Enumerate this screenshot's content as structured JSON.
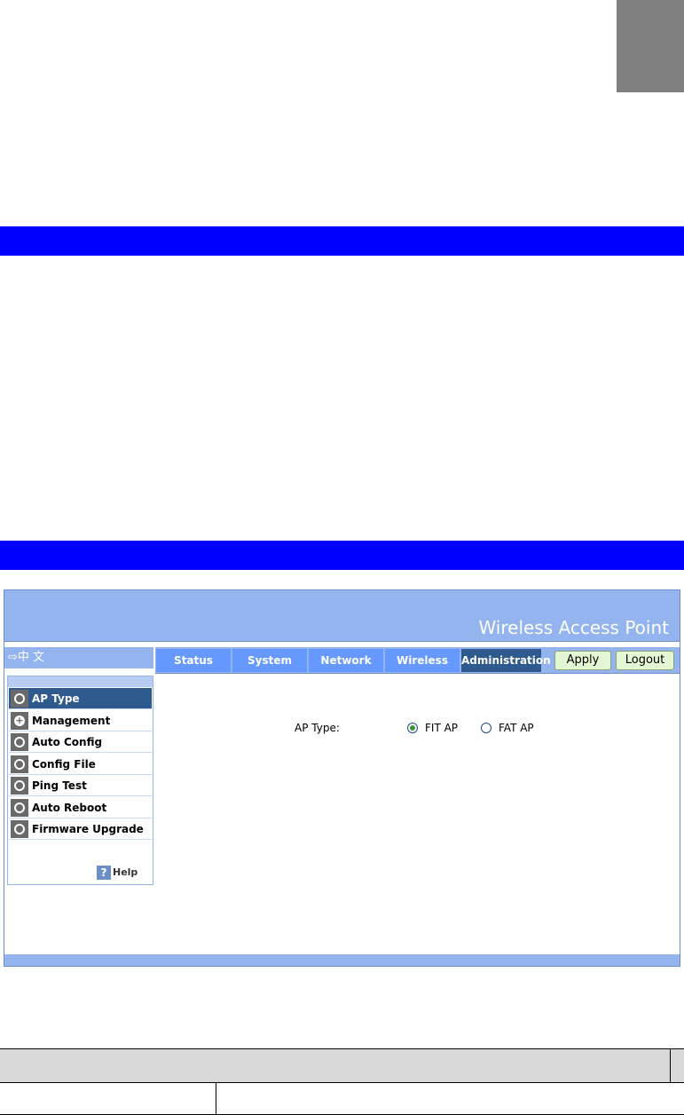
{
  "header": {
    "title": "Wireless Access Point"
  },
  "language_link": {
    "arrow": "⇨",
    "label": "中 文"
  },
  "tabs": [
    {
      "label": "Status",
      "active": false
    },
    {
      "label": "System",
      "active": false
    },
    {
      "label": "Network",
      "active": false
    },
    {
      "label": "Wireless",
      "active": false
    },
    {
      "label": "Administration",
      "active": true
    }
  ],
  "buttons": {
    "apply": "Apply",
    "logout": "Logout"
  },
  "sidebar": {
    "items": [
      {
        "label": "AP Type",
        "icon": "circle-icon",
        "active": true
      },
      {
        "label": "Management",
        "icon": "plus-icon",
        "active": false
      },
      {
        "label": "Auto Config",
        "icon": "circle-icon",
        "active": false
      },
      {
        "label": "Config File",
        "icon": "circle-icon",
        "active": false
      },
      {
        "label": "Ping Test",
        "icon": "circle-icon",
        "active": false
      },
      {
        "label": "Auto Reboot",
        "icon": "circle-icon",
        "active": false
      },
      {
        "label": "Firmware Upgrade",
        "icon": "circle-icon",
        "active": false
      }
    ],
    "help": {
      "icon": "?",
      "label": "Help"
    }
  },
  "form": {
    "ap_type_label": "AP Type:",
    "options": [
      {
        "label": "FIT AP",
        "selected": true
      },
      {
        "label": "FAT AP",
        "selected": false
      }
    ]
  },
  "colors": {
    "header_bg": "#93b4ee",
    "tab_bg": "#6699ff",
    "tab_active_bg": "#2e5a8e",
    "button_bg": "#e4f7d4",
    "page_bar": "#0000ff",
    "chapter_tab": "#808080"
  }
}
